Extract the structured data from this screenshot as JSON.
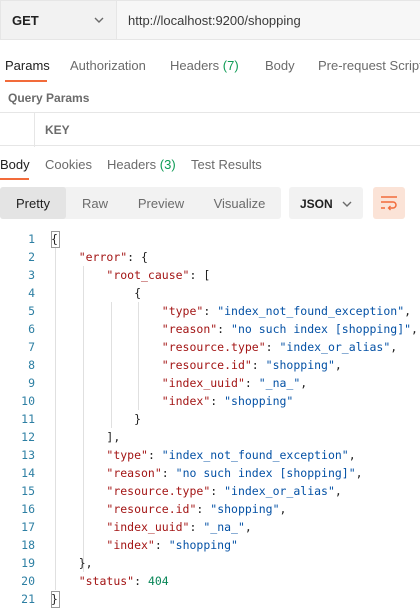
{
  "request": {
    "method": "GET",
    "url": "http://localhost:9200/shopping"
  },
  "request_tabs": [
    {
      "label": "Params",
      "active": true
    },
    {
      "label": "Authorization",
      "active": false
    },
    {
      "label": "Headers",
      "count": "(7)",
      "active": false
    },
    {
      "label": "Body",
      "active": false
    },
    {
      "label": "Pre-request Script",
      "active": false
    }
  ],
  "query_params": {
    "title": "Query Params",
    "key_header": "KEY"
  },
  "response_tabs": [
    {
      "label": "Body",
      "active": true
    },
    {
      "label": "Cookies",
      "active": false
    },
    {
      "label": "Headers",
      "count": "(3)",
      "active": false
    },
    {
      "label": "Test Results",
      "active": false
    }
  ],
  "view_modes": [
    {
      "label": "Pretty",
      "active": true
    },
    {
      "label": "Raw",
      "active": false
    },
    {
      "label": "Preview",
      "active": false
    },
    {
      "label": "Visualize",
      "active": false
    }
  ],
  "format": "JSON",
  "colors": {
    "accent": "#f26b3a",
    "count": "#0e9b55",
    "key": "#a31515",
    "string": "#0451a5",
    "number": "#098658",
    "line_number": "#2d7fa3"
  },
  "icons": {
    "method_dropdown": "chevron-down-icon",
    "format_dropdown": "chevron-down-icon",
    "wrap": "wrap-lines-icon"
  },
  "code_lines": [
    {
      "n": "1",
      "parts": [
        {
          "t": "p",
          "v": "{"
        }
      ]
    },
    {
      "n": "2",
      "parts": [
        {
          "t": "i",
          "v": "    "
        },
        {
          "t": "k",
          "v": "\"error\""
        },
        {
          "t": "p",
          "v": ": {"
        }
      ]
    },
    {
      "n": "3",
      "parts": [
        {
          "t": "i",
          "v": "        "
        },
        {
          "t": "k",
          "v": "\"root_cause\""
        },
        {
          "t": "p",
          "v": ": ["
        }
      ]
    },
    {
      "n": "4",
      "parts": [
        {
          "t": "i",
          "v": "            "
        },
        {
          "t": "p",
          "v": "{"
        }
      ]
    },
    {
      "n": "5",
      "parts": [
        {
          "t": "i",
          "v": "                "
        },
        {
          "t": "k",
          "v": "\"type\""
        },
        {
          "t": "p",
          "v": ": "
        },
        {
          "t": "s",
          "v": "\"index_not_found_exception\""
        },
        {
          "t": "p",
          "v": ","
        }
      ]
    },
    {
      "n": "6",
      "parts": [
        {
          "t": "i",
          "v": "                "
        },
        {
          "t": "k",
          "v": "\"reason\""
        },
        {
          "t": "p",
          "v": ": "
        },
        {
          "t": "s",
          "v": "\"no such index [shopping]\""
        },
        {
          "t": "p",
          "v": ","
        }
      ]
    },
    {
      "n": "7",
      "parts": [
        {
          "t": "i",
          "v": "                "
        },
        {
          "t": "k",
          "v": "\"resource.type\""
        },
        {
          "t": "p",
          "v": ": "
        },
        {
          "t": "s",
          "v": "\"index_or_alias\""
        },
        {
          "t": "p",
          "v": ","
        }
      ]
    },
    {
      "n": "8",
      "parts": [
        {
          "t": "i",
          "v": "                "
        },
        {
          "t": "k",
          "v": "\"resource.id\""
        },
        {
          "t": "p",
          "v": ": "
        },
        {
          "t": "s",
          "v": "\"shopping\""
        },
        {
          "t": "p",
          "v": ","
        }
      ]
    },
    {
      "n": "9",
      "parts": [
        {
          "t": "i",
          "v": "                "
        },
        {
          "t": "k",
          "v": "\"index_uuid\""
        },
        {
          "t": "p",
          "v": ": "
        },
        {
          "t": "s",
          "v": "\"_na_\""
        },
        {
          "t": "p",
          "v": ","
        }
      ]
    },
    {
      "n": "10",
      "parts": [
        {
          "t": "i",
          "v": "                "
        },
        {
          "t": "k",
          "v": "\"index\""
        },
        {
          "t": "p",
          "v": ": "
        },
        {
          "t": "s",
          "v": "\"shopping\""
        }
      ]
    },
    {
      "n": "11",
      "parts": [
        {
          "t": "i",
          "v": "            "
        },
        {
          "t": "p",
          "v": "}"
        }
      ]
    },
    {
      "n": "12",
      "parts": [
        {
          "t": "i",
          "v": "        "
        },
        {
          "t": "p",
          "v": "],"
        }
      ]
    },
    {
      "n": "13",
      "parts": [
        {
          "t": "i",
          "v": "        "
        },
        {
          "t": "k",
          "v": "\"type\""
        },
        {
          "t": "p",
          "v": ": "
        },
        {
          "t": "s",
          "v": "\"index_not_found_exception\""
        },
        {
          "t": "p",
          "v": ","
        }
      ]
    },
    {
      "n": "14",
      "parts": [
        {
          "t": "i",
          "v": "        "
        },
        {
          "t": "k",
          "v": "\"reason\""
        },
        {
          "t": "p",
          "v": ": "
        },
        {
          "t": "s",
          "v": "\"no such index [shopping]\""
        },
        {
          "t": "p",
          "v": ","
        }
      ]
    },
    {
      "n": "15",
      "parts": [
        {
          "t": "i",
          "v": "        "
        },
        {
          "t": "k",
          "v": "\"resource.type\""
        },
        {
          "t": "p",
          "v": ": "
        },
        {
          "t": "s",
          "v": "\"index_or_alias\""
        },
        {
          "t": "p",
          "v": ","
        }
      ]
    },
    {
      "n": "16",
      "parts": [
        {
          "t": "i",
          "v": "        "
        },
        {
          "t": "k",
          "v": "\"resource.id\""
        },
        {
          "t": "p",
          "v": ": "
        },
        {
          "t": "s",
          "v": "\"shopping\""
        },
        {
          "t": "p",
          "v": ","
        }
      ]
    },
    {
      "n": "17",
      "parts": [
        {
          "t": "i",
          "v": "        "
        },
        {
          "t": "k",
          "v": "\"index_uuid\""
        },
        {
          "t": "p",
          "v": ": "
        },
        {
          "t": "s",
          "v": "\"_na_\""
        },
        {
          "t": "p",
          "v": ","
        }
      ]
    },
    {
      "n": "18",
      "parts": [
        {
          "t": "i",
          "v": "        "
        },
        {
          "t": "k",
          "v": "\"index\""
        },
        {
          "t": "p",
          "v": ": "
        },
        {
          "t": "s",
          "v": "\"shopping\""
        }
      ]
    },
    {
      "n": "19",
      "parts": [
        {
          "t": "i",
          "v": "    "
        },
        {
          "t": "p",
          "v": "},"
        }
      ]
    },
    {
      "n": "20",
      "parts": [
        {
          "t": "i",
          "v": "    "
        },
        {
          "t": "k",
          "v": "\"status\""
        },
        {
          "t": "p",
          "v": ": "
        },
        {
          "t": "n",
          "v": "404"
        }
      ]
    },
    {
      "n": "21",
      "parts": [
        {
          "t": "p",
          "v": "}"
        }
      ]
    }
  ]
}
